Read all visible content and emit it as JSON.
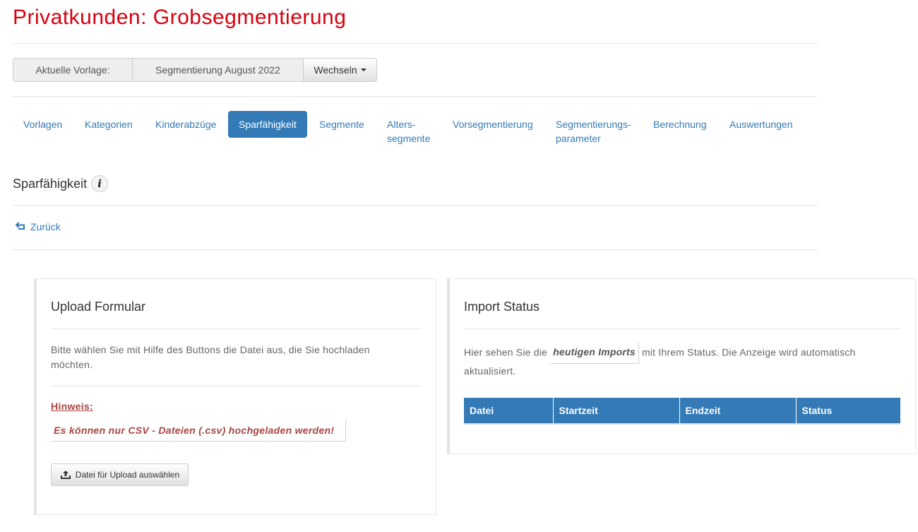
{
  "page": {
    "title": "Privatkunden: Grobsegmentierung"
  },
  "template": {
    "label": "Aktuelle Vorlage:",
    "value": "Segmentierung August 2022",
    "switch_label": "Wechseln"
  },
  "tabs": [
    {
      "label": "Vorlagen",
      "active": false
    },
    {
      "label": "Kategorien",
      "active": false
    },
    {
      "label": "Kinderabzüge",
      "active": false
    },
    {
      "label": "Sparfähigkeit",
      "active": true
    },
    {
      "label": "Segmente",
      "active": false
    },
    {
      "label": "Alters-\nsegmente",
      "active": false
    },
    {
      "label": "Vorsegmentierung",
      "active": false
    },
    {
      "label": "Segmentierungs-\nparameter",
      "active": false
    },
    {
      "label": "Berechnung",
      "active": false
    },
    {
      "label": "Auswertungen",
      "active": false
    }
  ],
  "section": {
    "title": "Sparfähigkeit",
    "info_icon": "info-icon"
  },
  "back": {
    "label": "Zurück",
    "icon": "return-arrow-icon"
  },
  "upload": {
    "title": "Upload Formular",
    "instruction": "Bitte wählen Sie mit Hilfe des Buttons die Datei aus, die Sie hochladen möchten.",
    "note_label": "Hinweis:",
    "note_text": "Es können nur CSV - Dateien (.csv) hochgeladen werden!",
    "button_label": "Datei für Upload auswählen",
    "button_icon": "upload-icon"
  },
  "import_status": {
    "title": "Import Status",
    "text_before": "Hier sehen Sie die",
    "highlight": "heutigen Imports",
    "text_after": "mit Ihrem Status. Die Anzeige wird automatisch aktualisiert.",
    "columns": [
      "Datei",
      "Startzeit",
      "Endzeit",
      "Status"
    ]
  },
  "colors": {
    "title_red": "#d9000d",
    "primary_blue": "#337ab7",
    "warning_red": "#a94442"
  }
}
